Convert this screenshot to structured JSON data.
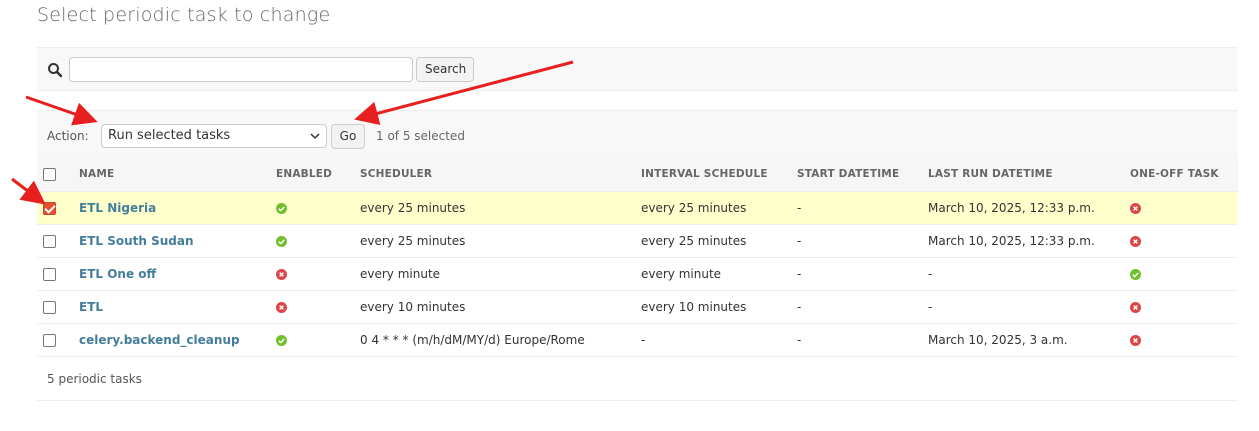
{
  "page_title": "Select periodic task to change",
  "search": {
    "value": "",
    "placeholder": "",
    "button_label": "Search",
    "icon": "search-icon"
  },
  "actions": {
    "label": "Action:",
    "selected_action": "Run selected tasks",
    "go_label": "Go",
    "counter": "1 of 5 selected"
  },
  "table": {
    "columns": [
      "NAME",
      "ENABLED",
      "SCHEDULER",
      "INTERVAL SCHEDULE",
      "START DATETIME",
      "LAST RUN DATETIME",
      "ONE-OFF TASK"
    ],
    "rows": [
      {
        "selected": true,
        "name": "ETL Nigeria",
        "enabled": true,
        "scheduler": "every 25 minutes",
        "interval_schedule": "every 25 minutes",
        "start_datetime": "-",
        "last_run": "March 10, 2025, 12:33 p.m.",
        "one_off": false
      },
      {
        "selected": false,
        "name": "ETL South Sudan",
        "enabled": true,
        "scheduler": "every 25 minutes",
        "interval_schedule": "every 25 minutes",
        "start_datetime": "-",
        "last_run": "March 10, 2025, 12:33 p.m.",
        "one_off": false
      },
      {
        "selected": false,
        "name": "ETL One off",
        "enabled": false,
        "scheduler": "every minute",
        "interval_schedule": "every minute",
        "start_datetime": "-",
        "last_run": "-",
        "one_off": true
      },
      {
        "selected": false,
        "name": "ETL",
        "enabled": false,
        "scheduler": "every 10 minutes",
        "interval_schedule": "every 10 minutes",
        "start_datetime": "-",
        "last_run": "-",
        "one_off": false
      },
      {
        "selected": false,
        "name": "celery.backend_cleanup",
        "enabled": true,
        "scheduler": "0 4 * * * (m/h/dM/MY/d) Europe/Rome",
        "interval_schedule": "-",
        "start_datetime": "-",
        "last_run": "March 10, 2025, 3 a.m.",
        "one_off": false
      }
    ]
  },
  "footer": {
    "count_text": "5 periodic tasks"
  },
  "colors": {
    "link": "#447e9b",
    "selected_row": "#ffffcc",
    "yes": "#70bf2b",
    "no": "#dd4646",
    "annotation_arrow": "#e81f1f"
  }
}
